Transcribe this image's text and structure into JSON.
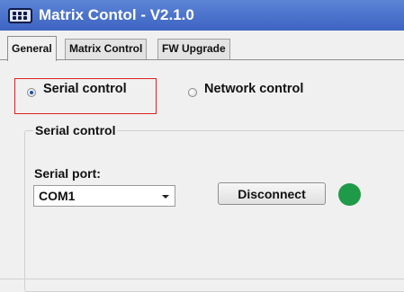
{
  "window": {
    "title": "Matrix Contol - V2.1.0",
    "icon": "matrix-device-icon"
  },
  "tabs": [
    {
      "label": "General",
      "active": true
    },
    {
      "label": "Matrix Control",
      "active": false
    },
    {
      "label": "FW Upgrade",
      "active": false
    }
  ],
  "control_mode": {
    "options": [
      {
        "label": "Serial control",
        "selected": true
      },
      {
        "label": "Network control",
        "selected": false
      }
    ]
  },
  "serial_group": {
    "title": "Serial control",
    "port_label": "Serial port:",
    "port_value": "COM1",
    "disconnect_label": "Disconnect",
    "status_color": "#1f9a48"
  },
  "colors": {
    "titlebar": "#4a72cc",
    "highlight": "#e02020"
  }
}
